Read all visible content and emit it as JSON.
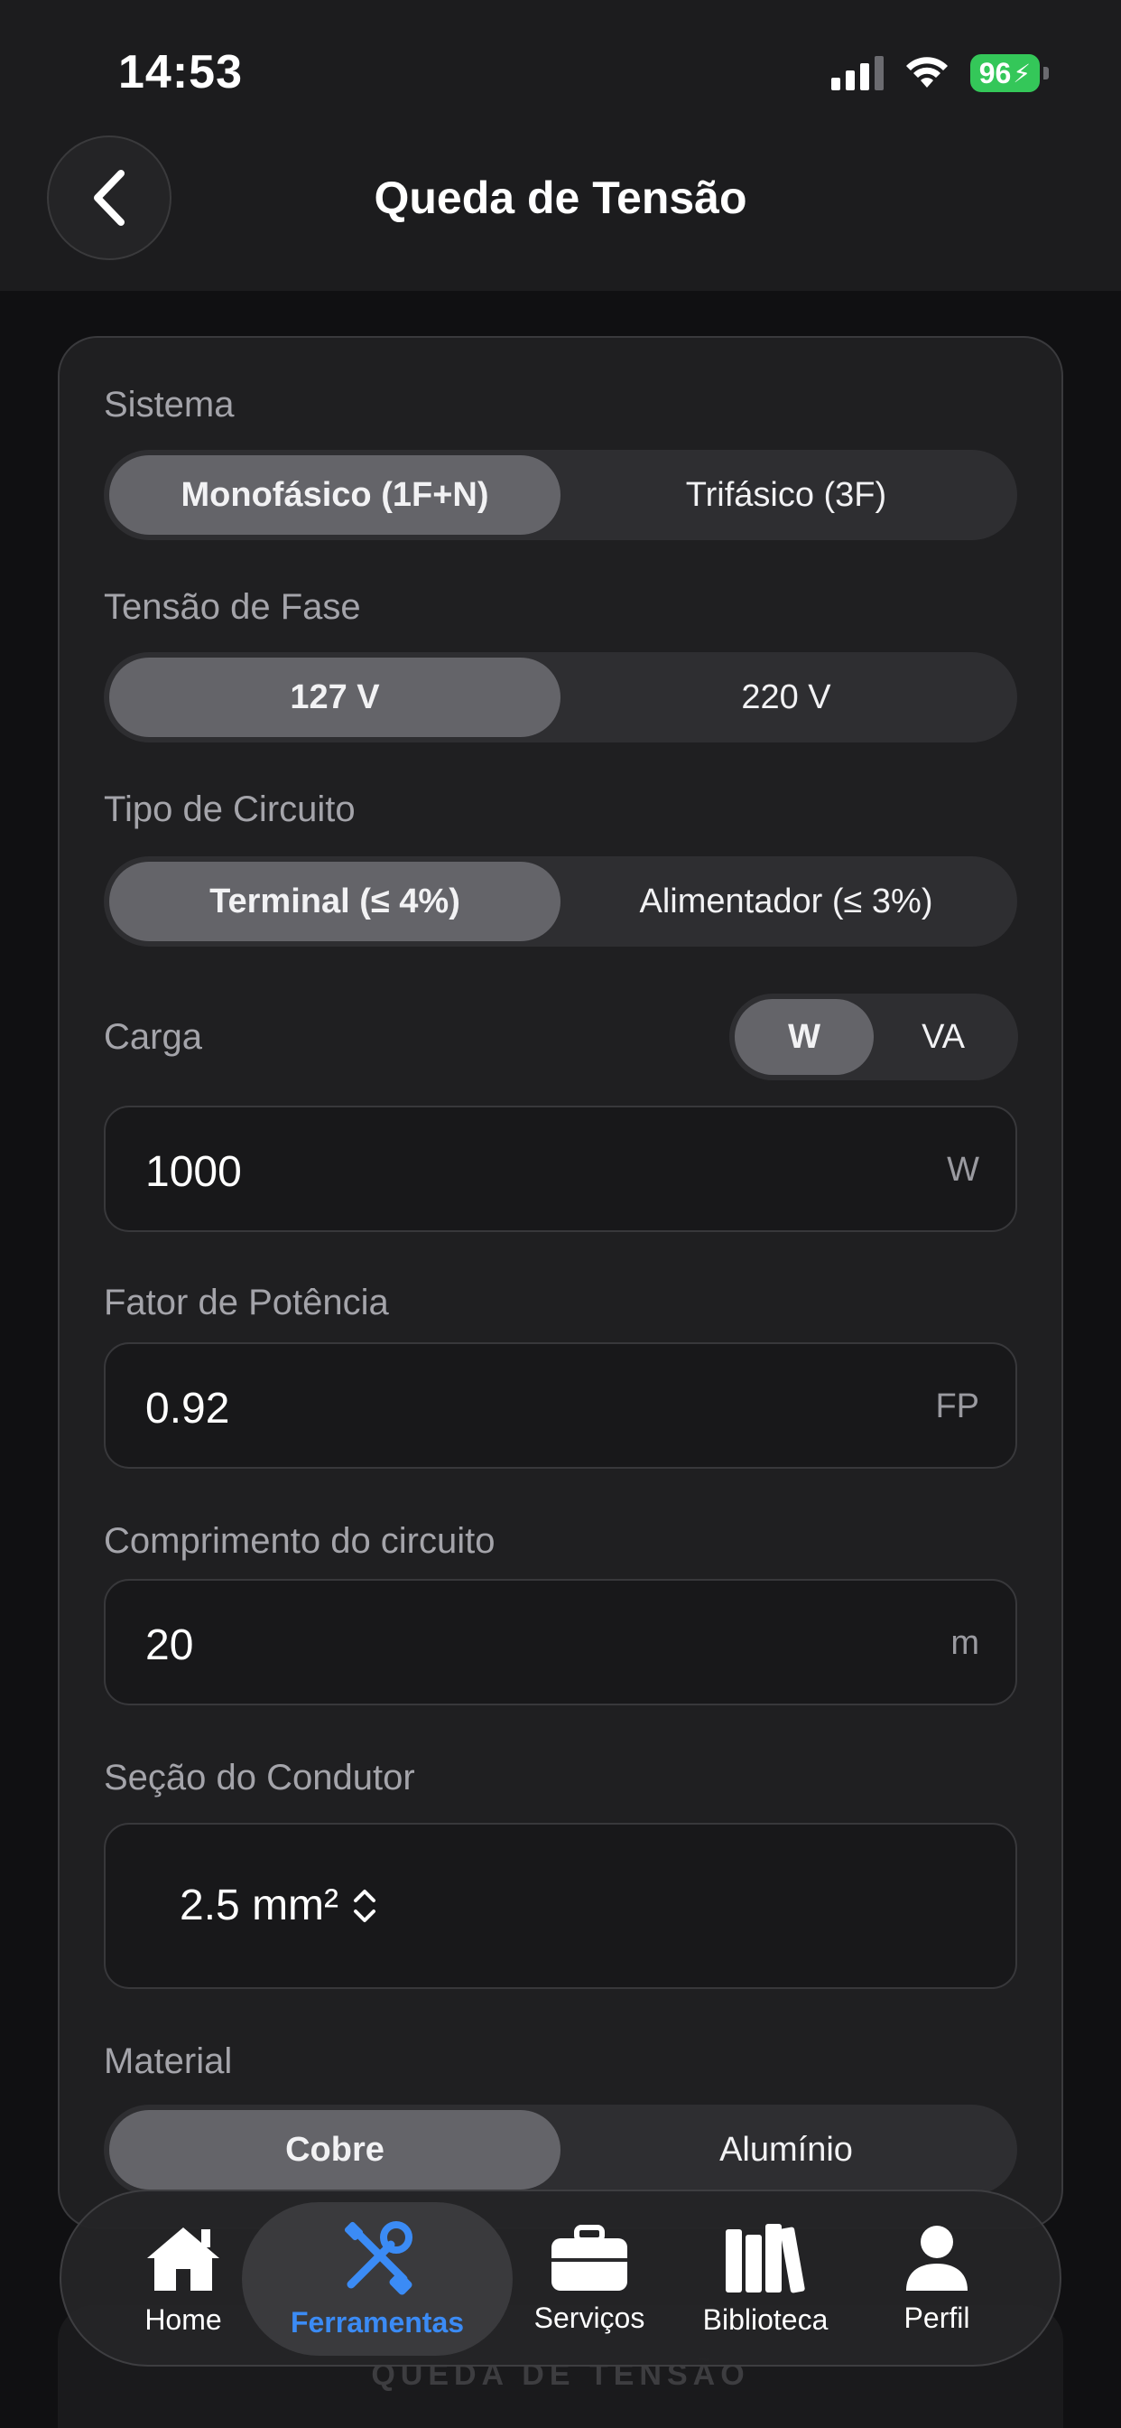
{
  "status": {
    "time": "14:53",
    "battery": "96"
  },
  "header": {
    "title": "Queda de Tensão"
  },
  "sistema": {
    "label": "Sistema",
    "options": [
      "Monofásico (1F+N)",
      "Trifásico (3F)"
    ],
    "selected": 0
  },
  "tensao": {
    "label": "Tensão de Fase",
    "options": [
      "127 V",
      "220 V"
    ],
    "selected": 0
  },
  "tipo": {
    "label": "Tipo de Circuito",
    "options": [
      "Terminal (≤ 4%)",
      "Alimentador (≤ 3%)"
    ],
    "selected": 0
  },
  "carga": {
    "label": "Carga",
    "unit_options": [
      "W",
      "VA"
    ],
    "unit_selected": 0,
    "value": "1000",
    "unit": "W"
  },
  "fator": {
    "label": "Fator de Potência",
    "value": "0.92",
    "unit": "FP"
  },
  "comprimento": {
    "label": "Comprimento do circuito",
    "value": "20",
    "unit": "m"
  },
  "secao": {
    "label": "Seção do Condutor",
    "value": "2.5 mm²"
  },
  "material": {
    "label": "Material",
    "options": [
      "Cobre",
      "Alumínio"
    ],
    "selected": 0
  },
  "peek_text": "QUEDA DE TENSÃO",
  "tabs": [
    {
      "label": "Home",
      "icon": "house-icon"
    },
    {
      "label": "Ferramentas",
      "icon": "tools-icon",
      "active": true
    },
    {
      "label": "Serviços",
      "icon": "briefcase-icon"
    },
    {
      "label": "Biblioteca",
      "icon": "books-icon"
    },
    {
      "label": "Perfil",
      "icon": "person-icon"
    }
  ],
  "colors": {
    "accent": "#3b8bf5",
    "battery": "#34c759",
    "background": "#101012",
    "card": "#1f1f21"
  }
}
